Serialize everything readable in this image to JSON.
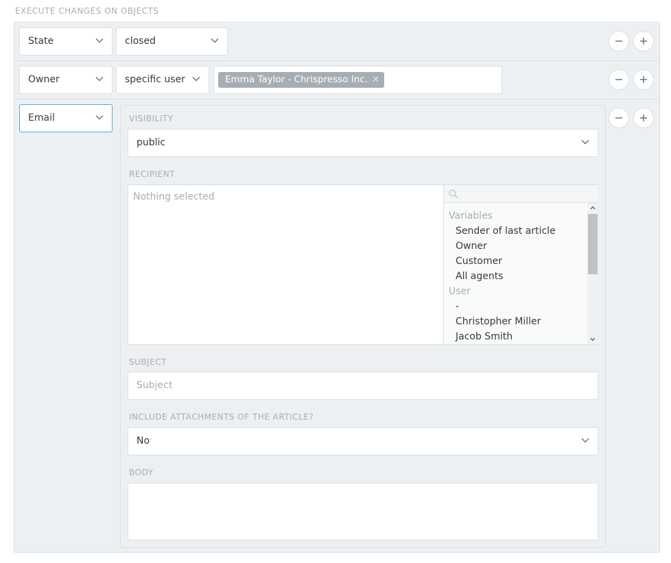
{
  "section_title": "EXECUTE CHANGES ON OBJECTS",
  "rows": [
    {
      "attribute": "State",
      "operator": "closed"
    },
    {
      "attribute": "Owner",
      "operator": "specific user",
      "token": "Emma Taylor - Chrispresso Inc."
    },
    {
      "attribute": "Email"
    }
  ],
  "email": {
    "visibility_label": "VISIBILITY",
    "visibility_value": "public",
    "recipient_label": "RECIPIENT",
    "recipient_empty": "Nothing selected",
    "recipient_groups": [
      {
        "name": "Variables",
        "items": [
          "Sender of last article",
          "Owner",
          "Customer",
          "All agents"
        ]
      },
      {
        "name": "User",
        "items": [
          "-",
          "Christopher Miller",
          "Jacob Smith"
        ]
      }
    ],
    "subject_label": "SUBJECT",
    "subject_placeholder": "Subject",
    "attachments_label": "INCLUDE ATTACHMENTS OF THE ARTICLE?",
    "attachments_value": "No",
    "body_label": "BODY"
  },
  "icons": {
    "remove": "minus-circle-icon",
    "add": "plus-circle-icon",
    "dropdown": "chevron-down-icon",
    "search": "search-icon",
    "remove_token": "close-icon"
  },
  "colors": {
    "panel_bg": "#edf0f2",
    "border": "#dcdfe1",
    "label": "#a6aeb3",
    "focus": "#50a8e1",
    "token_bg": "#a6aeb3"
  }
}
